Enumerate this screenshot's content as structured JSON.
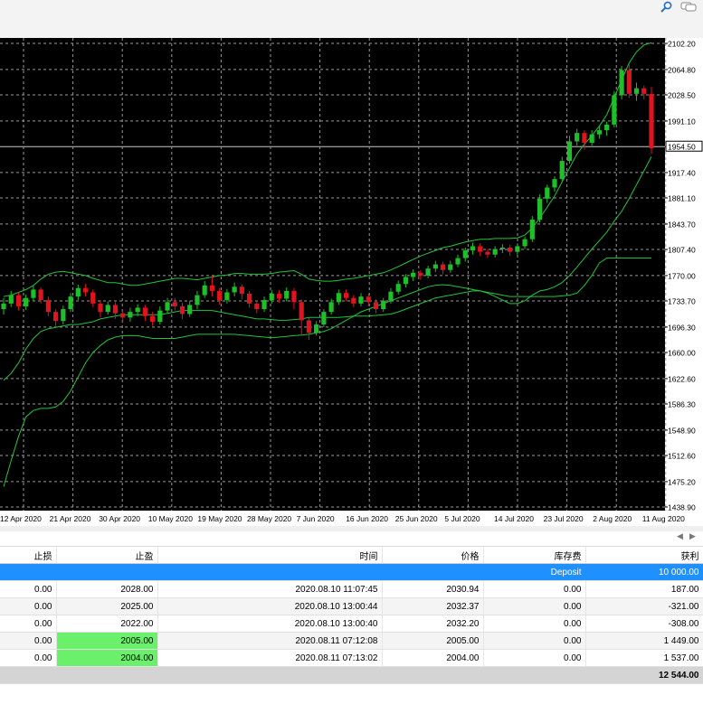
{
  "toolbar": {
    "icons": [
      "search-icon",
      "chat-icon"
    ]
  },
  "chart_data": {
    "type": "candlestick",
    "price_levels": [
      "2102.20",
      "2064.80",
      "2028.50",
      "1991.10",
      "1954.50",
      "1917.40",
      "1881.10",
      "1843.70",
      "1807.40",
      "1770.00",
      "1733.70",
      "1696.30",
      "1660.00",
      "1622.60",
      "1586.30",
      "1548.90",
      "1512.60",
      "1475.20",
      "1438.90"
    ],
    "current_price": "1954.50",
    "x_labels": [
      "12 Apr 2020",
      "21 Apr 2020",
      "30 Apr 2020",
      "10 May 2020",
      "19 May 2020",
      "28 May 2020",
      "7 Jun 2020",
      "16 Jun 2020",
      "25 Jun 2020",
      "5 Jul 2020",
      "14 Jul 2020",
      "23 Jul 2020",
      "2 Aug 2020",
      "11 Aug 2020"
    ],
    "ylim": [
      1438.9,
      2102.2
    ],
    "grid": true,
    "colors": {
      "bull": "#1fbf2a",
      "bear": "#e0141e",
      "band": "#23c43a",
      "grid": "#9a9a9a",
      "bg": "#000000"
    },
    "candles": [
      [
        1722,
        1730,
        1714,
        1738
      ],
      [
        1730,
        1742,
        1725,
        1748
      ],
      [
        1742,
        1726,
        1720,
        1746
      ],
      [
        1726,
        1738,
        1721,
        1743
      ],
      [
        1738,
        1750,
        1733,
        1755
      ],
      [
        1750,
        1735,
        1730,
        1753
      ],
      [
        1735,
        1718,
        1712,
        1740
      ],
      [
        1718,
        1705,
        1698,
        1722
      ],
      [
        1705,
        1722,
        1700,
        1727
      ],
      [
        1722,
        1740,
        1718,
        1745
      ],
      [
        1740,
        1752,
        1735,
        1757
      ],
      [
        1752,
        1746,
        1740,
        1758
      ],
      [
        1746,
        1730,
        1725,
        1750
      ],
      [
        1730,
        1718,
        1710,
        1735
      ],
      [
        1718,
        1728,
        1714,
        1733
      ],
      [
        1728,
        1716,
        1708,
        1732
      ],
      [
        1716,
        1710,
        1702,
        1721
      ],
      [
        1710,
        1718,
        1704,
        1724
      ],
      [
        1718,
        1724,
        1712,
        1729
      ],
      [
        1724,
        1712,
        1705,
        1728
      ],
      [
        1712,
        1704,
        1698,
        1718
      ],
      [
        1704,
        1720,
        1700,
        1726
      ],
      [
        1720,
        1732,
        1716,
        1738
      ],
      [
        1732,
        1726,
        1720,
        1738
      ],
      [
        1726,
        1715,
        1708,
        1731
      ],
      [
        1715,
        1728,
        1711,
        1734
      ],
      [
        1728,
        1742,
        1722,
        1748
      ],
      [
        1742,
        1756,
        1738,
        1762
      ],
      [
        1756,
        1748,
        1740,
        1770
      ],
      [
        1748,
        1735,
        1728,
        1752
      ],
      [
        1735,
        1746,
        1730,
        1751
      ],
      [
        1746,
        1754,
        1740,
        1760
      ],
      [
        1754,
        1744,
        1736,
        1758
      ],
      [
        1744,
        1730,
        1724,
        1748
      ],
      [
        1730,
        1722,
        1716,
        1734
      ],
      [
        1722,
        1735,
        1718,
        1740
      ],
      [
        1735,
        1744,
        1730,
        1749
      ],
      [
        1744,
        1737,
        1731,
        1749
      ],
      [
        1737,
        1748,
        1733,
        1753
      ],
      [
        1748,
        1732,
        1722,
        1752
      ],
      [
        1732,
        1706,
        1684,
        1736
      ],
      [
        1706,
        1688,
        1678,
        1710
      ],
      [
        1688,
        1700,
        1684,
        1705
      ],
      [
        1700,
        1718,
        1696,
        1722
      ],
      [
        1718,
        1732,
        1714,
        1737
      ],
      [
        1732,
        1745,
        1728,
        1750
      ],
      [
        1745,
        1738,
        1733,
        1750
      ],
      [
        1738,
        1730,
        1725,
        1742
      ],
      [
        1730,
        1740,
        1726,
        1745
      ],
      [
        1740,
        1732,
        1726,
        1744
      ],
      [
        1732,
        1722,
        1716,
        1736
      ],
      [
        1722,
        1734,
        1718,
        1738
      ],
      [
        1734,
        1747,
        1730,
        1752
      ],
      [
        1747,
        1758,
        1743,
        1763
      ],
      [
        1758,
        1768,
        1753,
        1772
      ],
      [
        1768,
        1774,
        1762,
        1779
      ],
      [
        1774,
        1770,
        1764,
        1778
      ],
      [
        1770,
        1780,
        1766,
        1784
      ],
      [
        1780,
        1786,
        1775,
        1791
      ],
      [
        1786,
        1778,
        1772,
        1790
      ],
      [
        1778,
        1786,
        1774,
        1791
      ],
      [
        1786,
        1795,
        1782,
        1800
      ],
      [
        1795,
        1806,
        1790,
        1810
      ],
      [
        1806,
        1812,
        1800,
        1817
      ],
      [
        1812,
        1804,
        1798,
        1816
      ],
      [
        1804,
        1800,
        1795,
        1808
      ],
      [
        1800,
        1808,
        1796,
        1812
      ],
      [
        1808,
        1810,
        1802,
        1815
      ],
      [
        1810,
        1804,
        1798,
        1814
      ],
      [
        1804,
        1812,
        1800,
        1816
      ],
      [
        1812,
        1822,
        1808,
        1826
      ],
      [
        1822,
        1850,
        1818,
        1855
      ],
      [
        1850,
        1880,
        1846,
        1886
      ],
      [
        1880,
        1896,
        1874,
        1900
      ],
      [
        1896,
        1908,
        1890,
        1912
      ],
      [
        1908,
        1934,
        1904,
        1940
      ],
      [
        1934,
        1962,
        1930,
        1970
      ],
      [
        1962,
        1974,
        1956,
        1980
      ],
      [
        1974,
        1960,
        1950,
        1978
      ],
      [
        1960,
        1972,
        1956,
        1978
      ],
      [
        1972,
        1978,
        1966,
        1984
      ],
      [
        1978,
        1986,
        1970,
        1990
      ],
      [
        1986,
        2028,
        1982,
        2034
      ],
      [
        2028,
        2064,
        2022,
        2070
      ],
      [
        2064,
        2030,
        2024,
        2072
      ],
      [
        2030,
        2038,
        2020,
        2046
      ],
      [
        2038,
        2030,
        2022,
        2042
      ],
      [
        2030,
        1952,
        1944,
        2040
      ]
    ],
    "band_upper": [
      1740,
      1742,
      1746,
      1750,
      1756,
      1765,
      1772,
      1775,
      1776,
      1774,
      1772,
      1770,
      1766,
      1763,
      1760,
      1760,
      1758,
      1756,
      1756,
      1758,
      1760,
      1762,
      1764,
      1766,
      1766,
      1765,
      1764,
      1766,
      1768,
      1770,
      1771,
      1773,
      1773,
      1772,
      1772,
      1772,
      1773,
      1775,
      1776,
      1777,
      1772,
      1765,
      1763,
      1762,
      1762,
      1763,
      1765,
      1766,
      1768,
      1770,
      1772,
      1774,
      1778,
      1783,
      1788,
      1793,
      1798,
      1802,
      1806,
      1810,
      1812,
      1815,
      1818,
      1820,
      1822,
      1822,
      1823,
      1823,
      1823,
      1824,
      1828,
      1838,
      1852,
      1868,
      1884,
      1904,
      1924,
      1944,
      1958,
      1970,
      1984,
      2000,
      2025,
      2050,
      2074,
      2090,
      2100,
      2103
    ],
    "band_mid": [
      1705,
      1708,
      1710,
      1712,
      1714,
      1716,
      1718,
      1720,
      1720,
      1720,
      1719,
      1718,
      1717,
      1716,
      1716,
      1716,
      1717,
      1718,
      1719,
      1720,
      1721,
      1722,
      1723,
      1724,
      1725,
      1726,
      1727,
      1728,
      1728,
      1728,
      1728,
      1728,
      1728,
      1727,
      1726,
      1726,
      1726,
      1726,
      1727,
      1728,
      1727,
      1724,
      1723,
      1723,
      1723,
      1724,
      1725,
      1726,
      1727,
      1728,
      1729,
      1731,
      1734,
      1738,
      1742,
      1747,
      1752,
      1756,
      1760,
      1764,
      1768,
      1772,
      1776,
      1780,
      1784,
      1786,
      1788,
      1790,
      1792,
      1795,
      1800,
      1806,
      1815,
      1826,
      1838,
      1851,
      1865,
      1880,
      1893,
      1906,
      1919,
      1933,
      1949,
      1966,
      1982,
      1995,
      2006,
      2014
    ],
    "band_lower": [
      1620,
      1630,
      1645,
      1665,
      1680,
      1690,
      1694,
      1696,
      1698,
      1700,
      1700,
      1702,
      1704,
      1708,
      1710,
      1712,
      1714,
      1714,
      1714,
      1714,
      1714,
      1714,
      1716,
      1718,
      1720,
      1720,
      1720,
      1720,
      1720,
      1718,
      1716,
      1714,
      1712,
      1710,
      1708,
      1708,
      1707,
      1706,
      1706,
      1707,
      1708,
      1710,
      1710,
      1710,
      1710,
      1710,
      1711,
      1712,
      1712,
      1712,
      1713,
      1714,
      1715,
      1718,
      1722,
      1726,
      1730,
      1734,
      1738,
      1740,
      1742,
      1744,
      1746,
      1748,
      1748,
      1745,
      1740,
      1735,
      1730,
      1730,
      1734,
      1742,
      1748,
      1750,
      1754,
      1760,
      1770,
      1782,
      1795,
      1808,
      1820,
      1832,
      1848,
      1862,
      1880,
      1900,
      1920,
      1940
    ],
    "band_outer": [
      1468,
      1505,
      1540,
      1568,
      1577,
      1580,
      1580,
      1582,
      1590,
      1605,
      1625,
      1645,
      1660,
      1670,
      1678,
      1682,
      1684,
      1684,
      1684,
      1682,
      1680,
      1680,
      1680,
      1680,
      1682,
      1684,
      1686,
      1686,
      1686,
      1686,
      1686,
      1686,
      1685,
      1684,
      1683,
      1682,
      1681,
      1682,
      1683,
      1684,
      1685,
      1686,
      1688,
      1690,
      1694,
      1700,
      1706,
      1712,
      1718,
      1722,
      1726,
      1730,
      1734,
      1738,
      1742,
      1746,
      1750,
      1754,
      1756,
      1757,
      1756,
      1754,
      1752,
      1750,
      1748,
      1746,
      1744,
      1742,
      1740,
      1740,
      1740,
      1740,
      1740,
      1740,
      1740,
      1741,
      1742,
      1745,
      1756,
      1770,
      1788,
      1795,
      1795,
      1795,
      1795,
      1795,
      1795,
      1795
    ]
  },
  "terminal": {
    "columns": [
      "止损",
      "止盈",
      "时间",
      "价格",
      "库存费",
      "获利"
    ],
    "deposit": {
      "label": "Deposit",
      "amount": "10 000.00"
    },
    "rows": [
      {
        "sl": "0.00",
        "tp": "2028.00",
        "time": "2020.08.10 11:07:45",
        "price": "2030.94",
        "swap": "0.00",
        "profit": "187.00",
        "tp_hit": false
      },
      {
        "sl": "0.00",
        "tp": "2025.00",
        "time": "2020.08.10 13:00:44",
        "price": "2032.37",
        "swap": "0.00",
        "profit": "-321.00",
        "tp_hit": false
      },
      {
        "sl": "0.00",
        "tp": "2022.00",
        "time": "2020.08.10 13:00:40",
        "price": "2032.20",
        "swap": "0.00",
        "profit": "-308.00",
        "tp_hit": false
      },
      {
        "sl": "0.00",
        "tp": "2005.00",
        "time": "2020.08.11 07:12:08",
        "price": "2005.00",
        "swap": "0.00",
        "profit": "1 449.00",
        "tp_hit": true
      },
      {
        "sl": "0.00",
        "tp": "2004.00",
        "time": "2020.08.11 07:13:02",
        "price": "2004.00",
        "swap": "0.00",
        "profit": "1 537.00",
        "tp_hit": true
      }
    ],
    "total": "12 544.00"
  }
}
